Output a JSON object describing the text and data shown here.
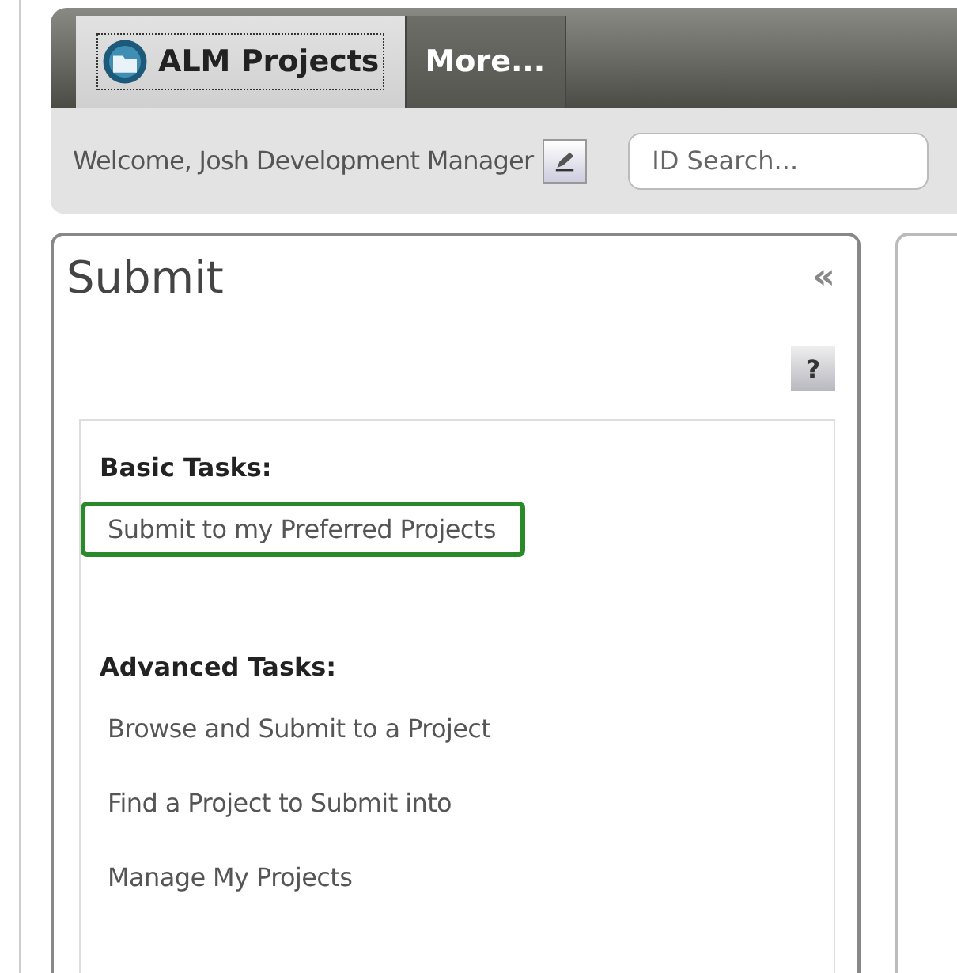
{
  "tabs": [
    {
      "label": "ALM Projects",
      "selected": true
    },
    {
      "label": "More...",
      "selected": false
    }
  ],
  "welcome": "Welcome, Josh Development Manager",
  "search": {
    "placeholder": "ID Search..."
  },
  "panel": {
    "title": "Submit",
    "collapse": "«",
    "help": "?",
    "groups": [
      {
        "heading": "Basic Tasks:",
        "items": [
          {
            "label": "Submit to my Preferred Projects",
            "selected": true
          }
        ]
      },
      {
        "heading": "Advanced Tasks:",
        "items": [
          {
            "label": "Browse and Submit to a Project",
            "selected": false
          },
          {
            "label": "Find a Project to Submit into",
            "selected": false
          },
          {
            "label": "Manage My Projects",
            "selected": false
          }
        ]
      }
    ]
  }
}
